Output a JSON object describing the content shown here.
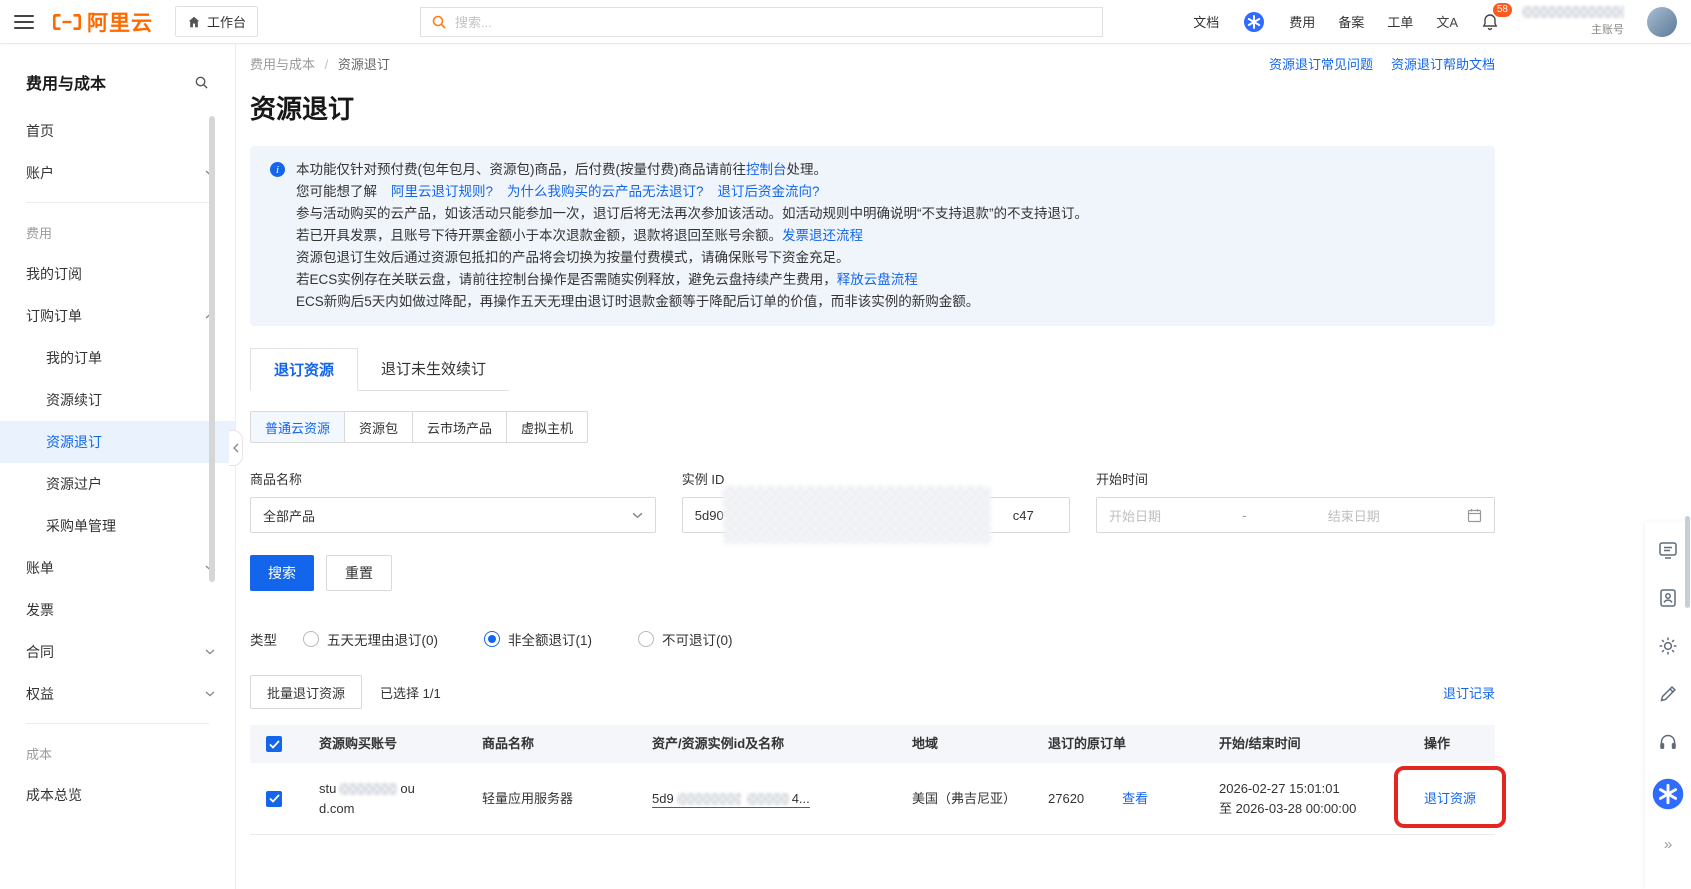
{
  "colors": {
    "brand_orange": "#ff6a00",
    "link_blue": "#1366ec",
    "annotation_red": "#e3261f",
    "info_bg": "#f0f5fb",
    "sidebar_active_bg": "#e9f2fd",
    "badge_orange": "#fa5a1e"
  },
  "topbar": {
    "logo_text": "阿里云",
    "workbench": "工作台",
    "search_placeholder": "搜索...",
    "nav_docs": "文档",
    "nav_fee": "费用",
    "nav_beian": "备案",
    "nav_ticket": "工单",
    "language_icon_text": "文A",
    "bell_badge": "58",
    "account_label": "主账号"
  },
  "sidebar": {
    "title": "费用与成本",
    "items": [
      {
        "label": "首页"
      },
      {
        "label": "账户"
      },
      {
        "label": "费用"
      },
      {
        "label": "我的订阅"
      },
      {
        "label": "订购订单"
      },
      {
        "label": "我的订单"
      },
      {
        "label": "资源续订"
      },
      {
        "label": "资源退订"
      },
      {
        "label": "资源过户"
      },
      {
        "label": "采购单管理"
      },
      {
        "label": "账单"
      },
      {
        "label": "发票"
      },
      {
        "label": "合同"
      },
      {
        "label": "权益"
      },
      {
        "label": "成本"
      },
      {
        "label": "成本总览"
      }
    ]
  },
  "breadcrumb": {
    "parent": "费用与成本",
    "separator": "/",
    "current": "资源退订"
  },
  "help_links": {
    "faq": "资源退订常见问题",
    "docs": "资源退订帮助文档"
  },
  "page_title": "资源退订",
  "infobox": {
    "line1": {
      "text": "本功能仅针对预付费(包年包月、资源包)商品，后付费(按量付费)商品请前往",
      "link": "控制台",
      "tail": "处理。"
    },
    "line2": {
      "intro": "您可能想了解",
      "links": [
        "阿里云退订规则?",
        "为什么我购买的云产品无法退订?",
        "退订后资金流向?"
      ]
    },
    "line3": "参与活动购买的云产品，如该活动只能参加一次，退订后将无法再次参加该活动。如活动规则中明确说明“不支持退款”的不支持退订。",
    "line4": {
      "text": "若已开具发票，且账号下待开票金额小于本次退款金额，退款将退回至账号余额。",
      "link": "发票退还流程"
    },
    "line5": "资源包退订生效后通过资源包抵扣的产品将会切换为按量付费模式，请确保账号下资金充足。",
    "line6": {
      "text": "若ECS实例存在关联云盘，请前往控制台操作是否需随实例释放，避免云盘持续产生费用，",
      "link": "释放云盘流程"
    },
    "line7": "ECS新购后5天内如做过降配，再操作五天无理由退订时退款金额等于降配后订单的价值，而非该实例的新购金额。"
  },
  "tabs": {
    "tab1": "退订资源",
    "tab2": "退订未生效续订"
  },
  "chips": [
    "普通云资源",
    "资源包",
    "云市场产品",
    "虚拟主机"
  ],
  "filters": {
    "product": {
      "label": "商品名称",
      "value": "全部产品"
    },
    "instance": {
      "label": "实例 ID",
      "value_prefix": "5d90",
      "value_suffix": "c47"
    },
    "time": {
      "label": "开始时间",
      "start_placeholder": "开始日期",
      "separator": "-",
      "end_placeholder": "结束日期"
    }
  },
  "buttons": {
    "search": "搜索",
    "reset": "重置"
  },
  "type_filter": {
    "label": "类型",
    "options": [
      {
        "label": "五天无理由退订(0)",
        "selected": false
      },
      {
        "label": "非全额退订(1)",
        "selected": true
      },
      {
        "label": "不可退订(0)",
        "selected": false
      }
    ]
  },
  "batch": {
    "button": "批量退订资源",
    "selected_text": "已选择 1/1",
    "record_link": "退订记录"
  },
  "table": {
    "columns": [
      "资源购买账号",
      "商品名称",
      "资产/资源实例id及名称",
      "地域",
      "退订的原订单",
      "开始/结束时间",
      "操作"
    ],
    "row": {
      "account_prefix": "stu",
      "account_suffix": "ou",
      "account_line2": "d.com",
      "product": "轻量应用服务器",
      "asset_prefix": "5d9",
      "asset_suffix": "4...",
      "region": "美国（弗吉尼亚）",
      "order_id": "27620",
      "view_link": "查看",
      "time_start": "2026-02-27 15:01:01",
      "time_end": "至 2026-03-28 00:00:00",
      "action": "退订资源"
    }
  },
  "side_panel": {
    "expand_glyph": "»"
  }
}
